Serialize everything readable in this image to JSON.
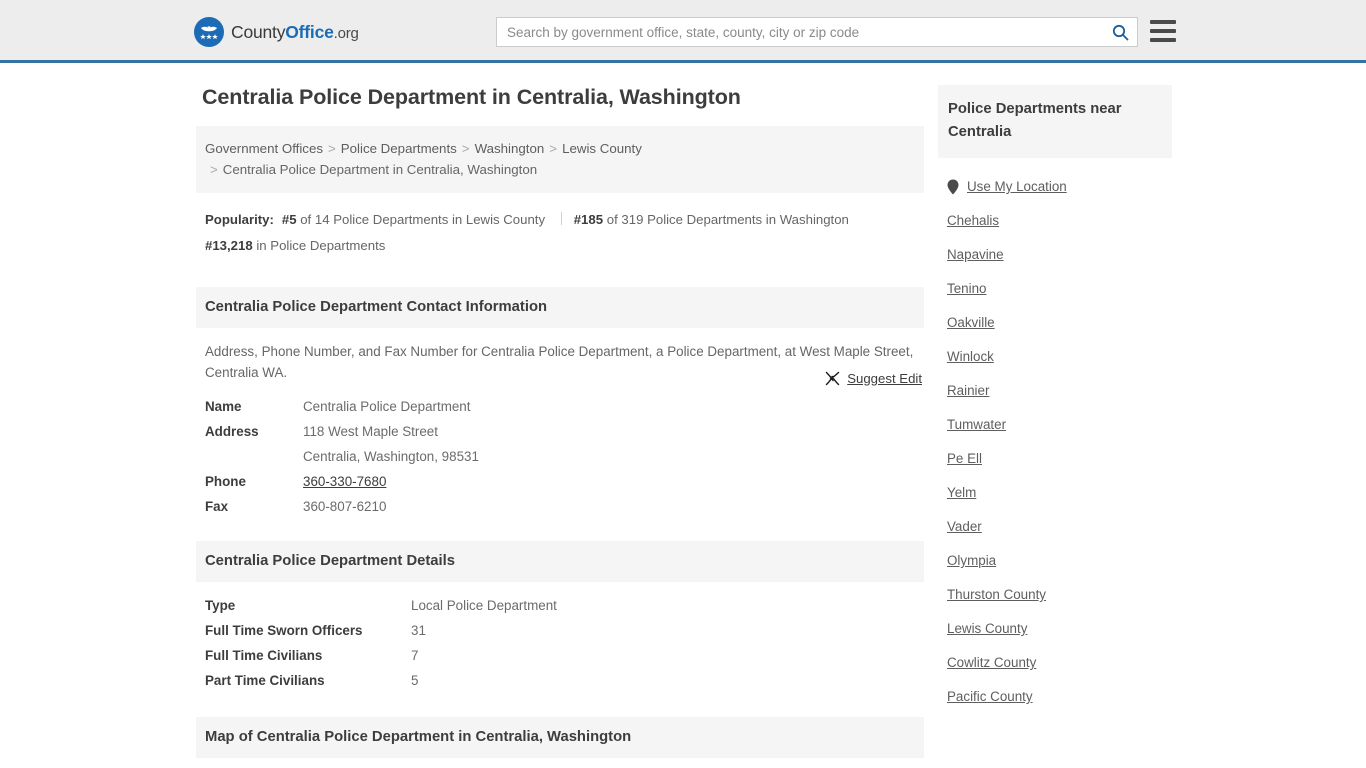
{
  "header": {
    "logo_text_part1": "County",
    "logo_text_part2": "Office",
    "logo_text_part3": ".org",
    "logo_icon": "eagle-stars-icon",
    "search_placeholder": "Search by government office, state, county, city or zip code",
    "search_value": "",
    "search_icon": "search-icon",
    "menu_icon": "hamburger-menu-icon",
    "accent_color": "#3573a5",
    "background_color": "#ededed"
  },
  "main": {
    "page_title": "Centralia Police Department in Centralia, Washington",
    "breadcrumb": {
      "items": [
        {
          "label": "Government Offices"
        },
        {
          "label": "Police Departments"
        },
        {
          "label": "Washington"
        },
        {
          "label": "Lewis County"
        }
      ],
      "current": "Centralia Police Department in Centralia, Washington",
      "separator": ">"
    },
    "popularity": {
      "label": "Popularity:",
      "county_rank": "#5",
      "county_rest": "of 14 Police Departments in Lewis County",
      "state_rank": "#185",
      "state_rest": "of 319 Police Departments in Washington",
      "national_rank": "#13,218",
      "national_rest": "in Police Departments"
    },
    "contact_section": {
      "heading": "Centralia Police Department Contact Information",
      "description": "Address, Phone Number, and Fax Number for Centralia Police Department, a Police Department, at West Maple Street, Centralia WA.",
      "suggest_edit_label": "Suggest Edit",
      "suggest_edit_icon": "pen-edit-icon",
      "rows": [
        {
          "key": "Name",
          "value": "Centralia Police Department",
          "link": false
        },
        {
          "key": "Address",
          "value": "118 West Maple Street",
          "link": false
        },
        {
          "key": "",
          "value": "Centralia, Washington, 98531",
          "link": false
        },
        {
          "key": "Phone",
          "value": "360-330-7680",
          "link": true
        },
        {
          "key": "Fax",
          "value": "360-807-6210",
          "link": false
        }
      ]
    },
    "details_section": {
      "heading": "Centralia Police Department Details",
      "rows": [
        {
          "key": "Type",
          "value": "Local Police Department"
        },
        {
          "key": "Full Time Sworn Officers",
          "value": "31"
        },
        {
          "key": "Full Time Civilians",
          "value": "7"
        },
        {
          "key": "Part Time Civilians",
          "value": "5"
        }
      ]
    },
    "map_section": {
      "heading": "Map of Centralia Police Department in Centralia, Washington"
    }
  },
  "sidebar": {
    "heading": "Police Departments near Centralia",
    "use_my_location": {
      "label": "Use My Location",
      "icon": "map-pin-icon"
    },
    "items": [
      {
        "label": "Chehalis"
      },
      {
        "label": "Napavine"
      },
      {
        "label": "Tenino"
      },
      {
        "label": "Oakville"
      },
      {
        "label": "Winlock"
      },
      {
        "label": "Rainier"
      },
      {
        "label": "Tumwater"
      },
      {
        "label": "Pe Ell"
      },
      {
        "label": "Yelm"
      },
      {
        "label": "Vader"
      },
      {
        "label": "Olympia"
      },
      {
        "label": "Thurston County"
      },
      {
        "label": "Lewis County"
      },
      {
        "label": "Cowlitz County"
      },
      {
        "label": "Pacific County"
      }
    ]
  }
}
